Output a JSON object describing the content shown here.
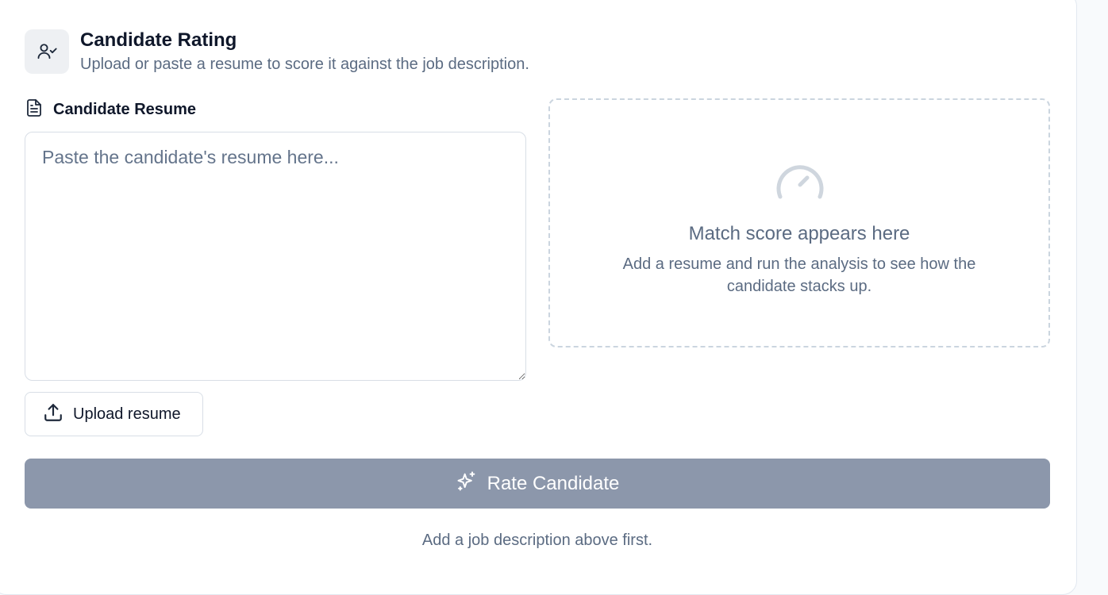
{
  "header": {
    "title": "Candidate Rating",
    "subtitle": "Upload or paste a resume to score it against the job description.",
    "icon": "user-check-icon"
  },
  "resume": {
    "label": "Candidate Resume",
    "label_icon": "file-text-icon",
    "placeholder": "Paste the candidate's resume here...",
    "value": ""
  },
  "upload": {
    "label": "Upload resume",
    "icon": "upload-icon"
  },
  "score_panel": {
    "icon": "gauge-icon",
    "title": "Match score appears here",
    "description": "Add a resume and run the analysis to see how the candidate stacks up."
  },
  "rate_button": {
    "label": "Rate Candidate",
    "icon": "sparkles-icon",
    "disabled": true
  },
  "hint": "Add a job description above first.",
  "colors": {
    "primary_disabled": "#8c97ab",
    "text_primary": "#0f172a",
    "text_muted": "#5b6b82",
    "border": "#d8dee6",
    "dashed_border": "#cbd5df"
  }
}
